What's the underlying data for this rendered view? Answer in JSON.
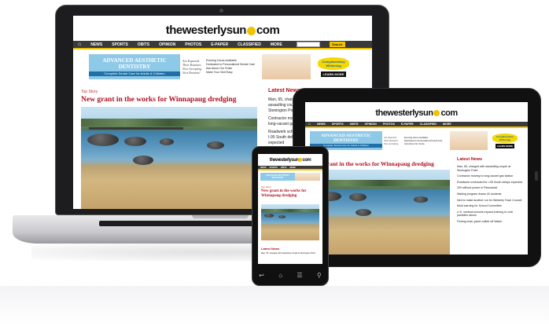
{
  "site": {
    "name_main": "thewesterlysun",
    "name_suffix": "com",
    "search_button": "Search",
    "nav": [
      "NEWS",
      "SPORTS",
      "OBITS",
      "OPINION",
      "PHOTOS",
      "E-PAPER",
      "CLASSIFIED",
      "MORE"
    ],
    "ad": {
      "title_line1": "ADVANCED AESTHETIC",
      "title_line2": "DENTISTRY",
      "subtitle": "Complete Dental Care for Adults & Children",
      "doctors": "Dr. Manuel Rubio D.M.D.   Dr. Julia Abeles D.M.D.",
      "tagline_1": "Are Expected",
      "tagline_2": "Their Routines",
      "tagline_3": "Now Accepting",
      "tagline_4": "New Patients!",
      "bullets": [
        "Evening Hours Available",
        "Dedicated to Personalized Dental Care",
        "Ask About Our Smile",
        "Make Your Visit Easy"
      ],
      "badge_text": "Complimentary Whitening",
      "badge_cta": "LEARN MORE"
    },
    "article": {
      "section": "Top Story",
      "headline": "New grant in the works for Winnapaug dredging"
    },
    "sidebar": {
      "title": "Latest News",
      "items": [
        "Man, 65, charged with assaulting couple at Stonington Point",
        "Contractor moving to long-vacant gas station",
        "Roadwork scheduled for I-95 South delays expected",
        "200 without power in Pawcatuck",
        "Waiting program draws 42 students",
        "Ned to make another run for Westerly Town Council",
        "Mold warning for School Committee",
        "U.S. medical schools expand training to curb painkiller abuse",
        "Fishing boat, yacht collide off Watch"
      ]
    }
  }
}
